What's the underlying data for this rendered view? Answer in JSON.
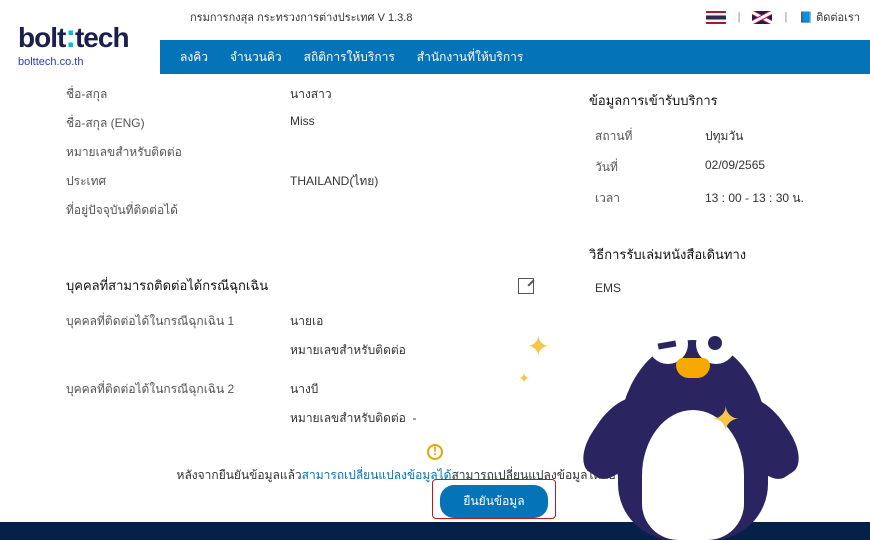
{
  "brand": {
    "name": "bolttech",
    "sub": "bolttech.co.th"
  },
  "topbar": {
    "title": "กรมการกงสุล กระทรวงการต่างประเทศ V 1.3.8",
    "facebook": "ติดต่อเรา"
  },
  "nav": {
    "item1": "ลงคิว",
    "item2": "จำนวนคิว",
    "item3": "สถิติการให้บริการ",
    "item4": "สำนักงานที่ให้บริการ"
  },
  "info": {
    "prefix_label": "ชื่อ-สกุล",
    "prefix_value": "นางสาว",
    "prefix_en_label": "ชื่อ-สกุล (ENG)",
    "prefix_en_value": "Miss",
    "phone_label": "หมายเลขสำหรับติดต่อ",
    "phone_value": "",
    "country_label": "ประเทศ",
    "country_value": "THAILAND(ไทย)",
    "address_label": "ที่อยู่ปัจจุบันที่ติดต่อได้",
    "address_value": ""
  },
  "emergency": {
    "title": "บุคคลที่สามารถติดต่อได้กรณีฉุกเฉิน",
    "p1_label": "บุคคลที่ติดต่อได้ในกรณีฉุกเฉิน 1",
    "p1_name": "นายเอ",
    "p1_phone_label": "หมายเลขสำหรับติดต่อ",
    "p1_phone": "",
    "p2_label": "บุคคลที่ติดต่อได้ในกรณีฉุกเฉิน 2",
    "p2_name": "นางบี",
    "p2_phone_label": "หมายเลขสำหรับติดต่อ",
    "p2_phone": "-"
  },
  "service": {
    "title": "ข้อมูลการเข้ารับบริการ",
    "place_label": "สถานที่",
    "place_value": "ปทุมวัน",
    "date_label": "วันที่",
    "date_value": "02/09/2565",
    "time_label": "เวลา",
    "time_value": "13 : 00 - 13 : 30   น."
  },
  "receive": {
    "title": "วิธีการรับเล่มหนังสือเดินทาง",
    "method": "EMS"
  },
  "notice": {
    "prefix": "หลังจากยืนยันข้อมูลแล้ว",
    "link": "สามารถเปลี่ยนแปลงข้อมูลได้",
    "suffix": "สามารถเปลี่ยนแปลงข้อมูลได้ก่อน 23.00 น.ของ"
  },
  "confirm": {
    "label": "ยืนยันข้อมูล"
  }
}
